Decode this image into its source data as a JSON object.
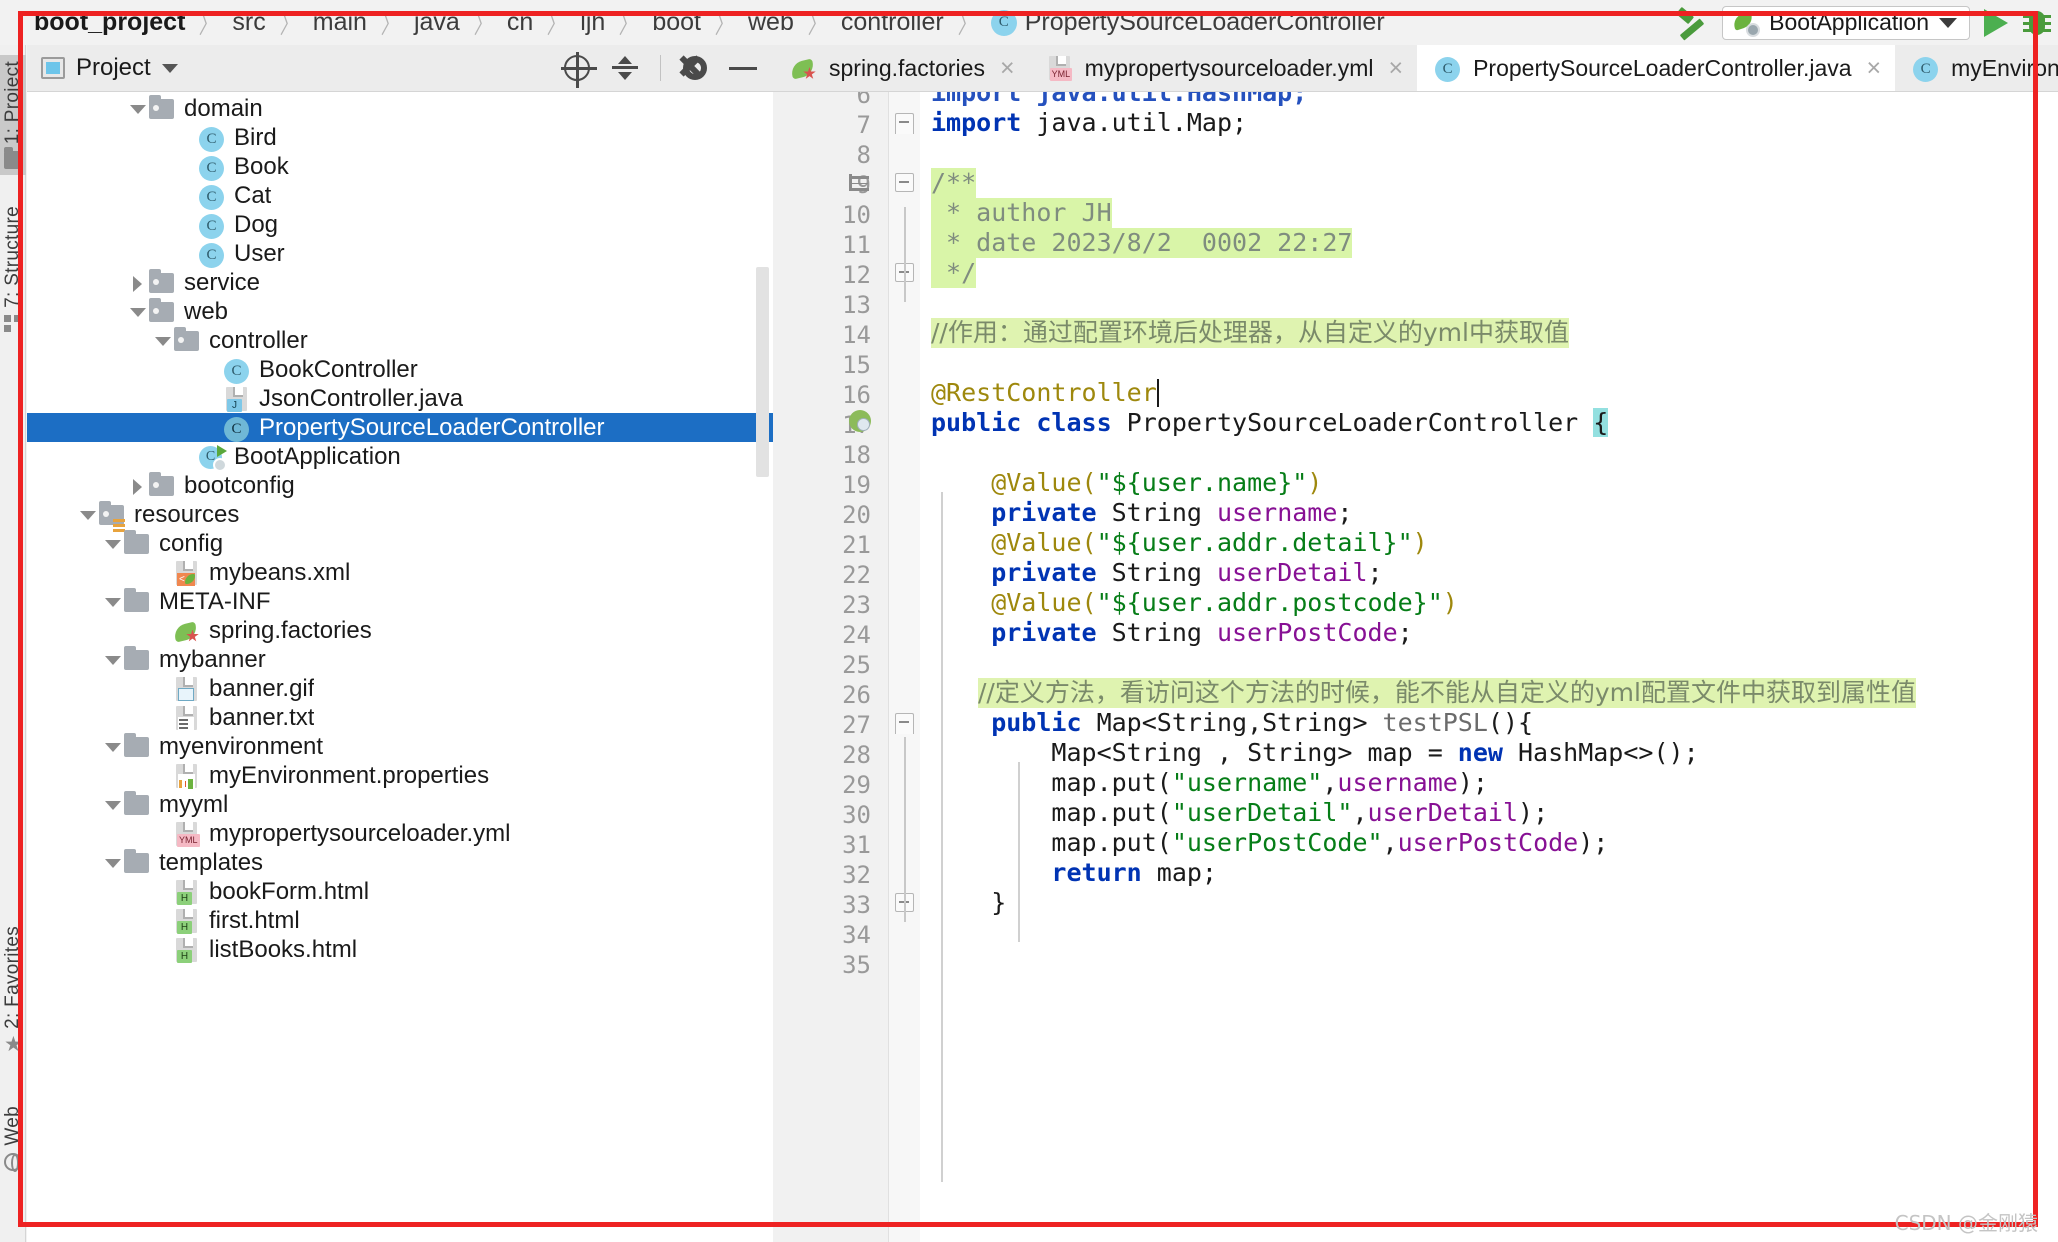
{
  "breadcrumb": {
    "items": [
      "boot_project",
      "src",
      "main",
      "java",
      "cn",
      "ljh",
      "boot",
      "web",
      "controller"
    ],
    "class_label": "PropertySourceLoaderController",
    "class_icon": "C"
  },
  "toolbar": {
    "build_icon": "hammer-icon",
    "run_config": "BootApplication",
    "run_icon": "run-icon",
    "debug_icon": "debug-icon"
  },
  "left_strip": {
    "tabs": [
      {
        "label": "1: Project",
        "icon": "folder-icon",
        "active": true
      },
      {
        "label": "7: Structure",
        "icon": "structure-icon",
        "active": false
      },
      {
        "label": "2: Favorites",
        "icon": "star-icon",
        "active": false
      },
      {
        "label": "Web",
        "icon": "globe-icon",
        "active": false
      }
    ]
  },
  "project_panel": {
    "title": "Project",
    "actions": [
      "locate-icon",
      "collapse-all-icon",
      "settings-icon",
      "minimize-icon"
    ],
    "tree": [
      {
        "label": "domain",
        "indent": 4,
        "arrow": "down",
        "icon": "folder",
        "sel": false
      },
      {
        "label": "Bird",
        "indent": 6,
        "arrow": "none",
        "icon": "class",
        "sel": false
      },
      {
        "label": "Book",
        "indent": 6,
        "arrow": "none",
        "icon": "class",
        "sel": false
      },
      {
        "label": "Cat",
        "indent": 6,
        "arrow": "none",
        "icon": "class",
        "sel": false
      },
      {
        "label": "Dog",
        "indent": 6,
        "arrow": "none",
        "icon": "class",
        "sel": false
      },
      {
        "label": "User",
        "indent": 6,
        "arrow": "none",
        "icon": "class",
        "sel": false
      },
      {
        "label": "service",
        "indent": 4,
        "arrow": "right",
        "icon": "folder",
        "sel": false
      },
      {
        "label": "web",
        "indent": 4,
        "arrow": "down",
        "icon": "folder",
        "sel": false
      },
      {
        "label": "controller",
        "indent": 5,
        "arrow": "down",
        "icon": "folder",
        "sel": false
      },
      {
        "label": "BookController",
        "indent": 7,
        "arrow": "none",
        "icon": "class",
        "sel": false
      },
      {
        "label": "JsonController.java",
        "indent": 7,
        "arrow": "none",
        "icon": "java-file",
        "sel": false
      },
      {
        "label": "PropertySourceLoaderController",
        "indent": 7,
        "arrow": "none",
        "icon": "class",
        "sel": true
      },
      {
        "label": "BootApplication",
        "indent": 6,
        "arrow": "none",
        "icon": "boot-app",
        "sel": false
      },
      {
        "label": "bootconfig",
        "indent": 4,
        "arrow": "right",
        "icon": "folder",
        "sel": false
      },
      {
        "label": "resources",
        "indent": 2,
        "arrow": "down",
        "icon": "resources-folder",
        "sel": false
      },
      {
        "label": "config",
        "indent": 3,
        "arrow": "down",
        "icon": "folder-plain",
        "sel": false
      },
      {
        "label": "mybeans.xml",
        "indent": 5,
        "arrow": "none",
        "icon": "xml-file",
        "sel": false
      },
      {
        "label": "META-INF",
        "indent": 3,
        "arrow": "down",
        "icon": "folder-plain",
        "sel": false
      },
      {
        "label": "spring.factories",
        "indent": 5,
        "arrow": "none",
        "icon": "spring-file",
        "sel": false
      },
      {
        "label": "mybanner",
        "indent": 3,
        "arrow": "down",
        "icon": "folder-plain",
        "sel": false
      },
      {
        "label": "banner.gif",
        "indent": 5,
        "arrow": "none",
        "icon": "image-file",
        "sel": false
      },
      {
        "label": "banner.txt",
        "indent": 5,
        "arrow": "none",
        "icon": "text-file",
        "sel": false
      },
      {
        "label": "myenvironment",
        "indent": 3,
        "arrow": "down",
        "icon": "folder-plain",
        "sel": false
      },
      {
        "label": "myEnvironment.properties",
        "indent": 5,
        "arrow": "none",
        "icon": "properties-file",
        "sel": false
      },
      {
        "label": "myyml",
        "indent": 3,
        "arrow": "down",
        "icon": "folder-plain",
        "sel": false
      },
      {
        "label": "mypropertysourceloader.yml",
        "indent": 5,
        "arrow": "none",
        "icon": "yml-file",
        "sel": false
      },
      {
        "label": "templates",
        "indent": 3,
        "arrow": "down",
        "icon": "folder-plain",
        "sel": false
      },
      {
        "label": "bookForm.html",
        "indent": 5,
        "arrow": "none",
        "icon": "html-file",
        "sel": false
      },
      {
        "label": "first.html",
        "indent": 5,
        "arrow": "none",
        "icon": "html-file",
        "sel": false
      },
      {
        "label": "listBooks.html",
        "indent": 5,
        "arrow": "none",
        "icon": "html-file",
        "sel": false
      }
    ]
  },
  "editor": {
    "tabs": [
      {
        "label": "spring.factories",
        "icon": "spring-file",
        "active": false,
        "closable": true
      },
      {
        "label": "mypropertysourceloader.yml",
        "icon": "yml-file",
        "active": false,
        "closable": true
      },
      {
        "label": "PropertySourceLoaderController.java",
        "icon": "class",
        "active": true,
        "closable": true
      },
      {
        "label": "myEnviron",
        "icon": "class",
        "active": false,
        "closable": false
      }
    ],
    "code_lines": [
      {
        "n": "6",
        "partial": true,
        "tokens": [
          {
            "t": "import java.util.HashMap;",
            "c": "kw"
          }
        ]
      },
      {
        "n": "7",
        "fold": "open-top",
        "tokens": [
          {
            "t": "import",
            "c": "kw"
          },
          {
            "t": " java.util.Map;",
            "c": "pl"
          }
        ]
      },
      {
        "n": "8",
        "tokens": []
      },
      {
        "n": "9",
        "bookmark": true,
        "fold": "box",
        "hl": true,
        "tokens": [
          {
            "t": "/**",
            "c": "cm"
          }
        ]
      },
      {
        "n": "10",
        "hl": true,
        "tokens": [
          {
            "t": " * author JH",
            "c": "cm"
          }
        ]
      },
      {
        "n": "11",
        "hl": true,
        "tokens": [
          {
            "t": " * date 2023/8/2  0002 22:27",
            "c": "cm"
          }
        ]
      },
      {
        "n": "12",
        "fold": "box",
        "hl": true,
        "tokens": [
          {
            "t": " */",
            "c": "cm"
          }
        ]
      },
      {
        "n": "13",
        "tokens": []
      },
      {
        "n": "14",
        "hlcjk": true,
        "tokens": [
          {
            "t": "//作用：通过配置环境后处理器，从自定义的yml中获取值",
            "c": "cjk"
          }
        ]
      },
      {
        "n": "15",
        "tokens": []
      },
      {
        "n": "16",
        "tokens": [
          {
            "t": "@RestController",
            "c": "ann"
          }
        ]
      },
      {
        "n": "17",
        "run": true,
        "tokens": [
          {
            "t": "public class",
            "c": "kw"
          },
          {
            "t": " PropertySourceLoaderController ",
            "c": "pl"
          },
          {
            "t": "{",
            "c": "brace"
          }
        ]
      },
      {
        "n": "18",
        "tokens": []
      },
      {
        "n": "19",
        "tokens": [
          {
            "t": "    @Value(",
            "c": "ann"
          },
          {
            "t": "\"${user.name}\"",
            "c": "str"
          },
          {
            "t": ")",
            "c": "ann"
          }
        ]
      },
      {
        "n": "20",
        "tokens": [
          {
            "t": "    private",
            "c": "kw"
          },
          {
            "t": " String ",
            "c": "pl"
          },
          {
            "t": "username",
            "c": "fld"
          },
          {
            "t": ";",
            "c": "pl"
          }
        ]
      },
      {
        "n": "21",
        "tokens": [
          {
            "t": "    @Value(",
            "c": "ann"
          },
          {
            "t": "\"${user.addr.detail}\"",
            "c": "str"
          },
          {
            "t": ")",
            "c": "ann"
          }
        ]
      },
      {
        "n": "22",
        "tokens": [
          {
            "t": "    private",
            "c": "kw"
          },
          {
            "t": " String ",
            "c": "pl"
          },
          {
            "t": "userDetail",
            "c": "fld"
          },
          {
            "t": ";",
            "c": "pl"
          }
        ]
      },
      {
        "n": "23",
        "tokens": [
          {
            "t": "    @Value(",
            "c": "ann"
          },
          {
            "t": "\"${user.addr.postcode}\"",
            "c": "str"
          },
          {
            "t": ")",
            "c": "ann"
          }
        ]
      },
      {
        "n": "24",
        "tokens": [
          {
            "t": "    private",
            "c": "kw"
          },
          {
            "t": " String ",
            "c": "pl"
          },
          {
            "t": "userPostCode",
            "c": "fld"
          },
          {
            "t": ";",
            "c": "pl"
          }
        ]
      },
      {
        "n": "25",
        "tokens": []
      },
      {
        "n": "26",
        "hlcjk": true,
        "indentcjk": true,
        "tokens": [
          {
            "t": "//定义方法，看访问这个方法的时候，能不能从自定义的yml配置文件中获取到属性值",
            "c": "cjk"
          }
        ]
      },
      {
        "n": "27",
        "fold": "open-top",
        "tokens": [
          {
            "t": "    public",
            "c": "kw"
          },
          {
            "t": " Map<String,String> ",
            "c": "pl"
          },
          {
            "t": "testPSL",
            "c": "mth"
          },
          {
            "t": "(){",
            "c": "pl"
          }
        ]
      },
      {
        "n": "28",
        "tokens": [
          {
            "t": "        Map<String , String> map = ",
            "c": "pl"
          },
          {
            "t": "new",
            "c": "kw"
          },
          {
            "t": " HashMap<>();",
            "c": "pl"
          }
        ]
      },
      {
        "n": "29",
        "tokens": [
          {
            "t": "        map.put(",
            "c": "pl"
          },
          {
            "t": "\"username\"",
            "c": "str"
          },
          {
            "t": ",",
            "c": "pl"
          },
          {
            "t": "username",
            "c": "fld"
          },
          {
            "t": ");",
            "c": "pl"
          }
        ]
      },
      {
        "n": "30",
        "tokens": [
          {
            "t": "        map.put(",
            "c": "pl"
          },
          {
            "t": "\"userDetail\"",
            "c": "str"
          },
          {
            "t": ",",
            "c": "pl"
          },
          {
            "t": "userDetail",
            "c": "fld"
          },
          {
            "t": ");",
            "c": "pl"
          }
        ]
      },
      {
        "n": "31",
        "tokens": [
          {
            "t": "        map.put(",
            "c": "pl"
          },
          {
            "t": "\"userPostCode\"",
            "c": "str"
          },
          {
            "t": ",",
            "c": "pl"
          },
          {
            "t": "userPostCode",
            "c": "fld"
          },
          {
            "t": ");",
            "c": "pl"
          }
        ]
      },
      {
        "n": "32",
        "tokens": [
          {
            "t": "        return",
            "c": "kw"
          },
          {
            "t": " map;",
            "c": "pl"
          }
        ]
      },
      {
        "n": "33",
        "fold": "box",
        "tokens": [
          {
            "t": "    }",
            "c": "pl"
          }
        ]
      },
      {
        "n": "34",
        "tokens": []
      },
      {
        "n": "35",
        "partial": true,
        "tokens": []
      }
    ]
  },
  "watermark": "CSDN @金刚猿",
  "colors": {
    "selection": "#1c6ec4",
    "annotation_box": "#ee2222",
    "comment_highlight": "#d9f5a8",
    "keyword": "#0033b3",
    "string": "#067d17",
    "annotation": "#9e880d",
    "field": "#871094"
  }
}
